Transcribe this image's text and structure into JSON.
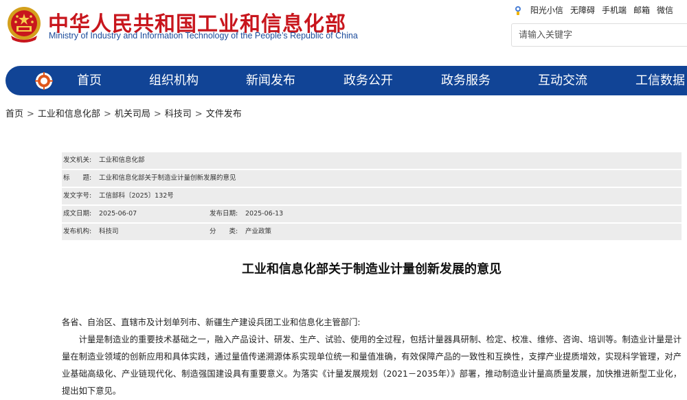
{
  "header": {
    "title": "中华人民共和国工业和信息化部",
    "subtitle": "Ministry of Industry and Information Technology of the People’s Republic of China",
    "top_links": [
      "阳光小信",
      "无障碍",
      "手机端",
      "邮箱",
      "微信"
    ],
    "search_placeholder": "请输入关键字"
  },
  "nav": {
    "items": [
      "首页",
      "组织机构",
      "新闻发布",
      "政务公开",
      "政务服务",
      "互动交流",
      "工信数据"
    ]
  },
  "breadcrumb": [
    "首页",
    "工业和信息化部",
    "机关司局",
    "科技司",
    "文件发布"
  ],
  "info": {
    "issuer_label": "发文机关:",
    "issuer": "工业和信息化部",
    "title_label": "标　　题:",
    "title": "工业和信息化部关于制造业计量创新发展的意见",
    "doc_no_label": "发文字号:",
    "doc_no": "工信部科〔2025〕132号",
    "date_label": "成文日期:",
    "date": "2025-06-07",
    "publish_label": "发布日期:",
    "publish_date": "2025-06-13",
    "org_label": "发布机构:",
    "org": "科技司",
    "category_label": "分　　类:",
    "category": "产业政策"
  },
  "article": {
    "title": "工业和信息化部关于制造业计量创新发展的意见",
    "addressee": "各省、自治区、直辖市及计划单列市、新疆生产建设兵团工业和信息化主管部门:",
    "para1": "计量是制造业的重要技术基础之一，融入产品设计、研发、生产、试验、使用的全过程，包括计量器具研制、检定、校准、维修、咨询、培训等。制造业计量是计量在制造业领域的创新应用和具体实践，通过量值传递溯源体系实现单位统一和量值准确，有效保障产品的一致性和互换性，支撑产业提质增效，实现科学管理，对产业基础高级化、产业链现代化、制造强国建设具有重要意义。为落实《计量发展规划（2021－2035年）》部署，推动制造业计量高质量发展，加快推进新型工业化，提出如下意见。"
  },
  "colors": {
    "brand_red": "#c8161d",
    "nav_blue": "#114496",
    "info_bg": "#ececec"
  },
  "icons": [
    "national-emblem-icon",
    "sunshine-mascot-icon",
    "nav-logo-icon"
  ]
}
